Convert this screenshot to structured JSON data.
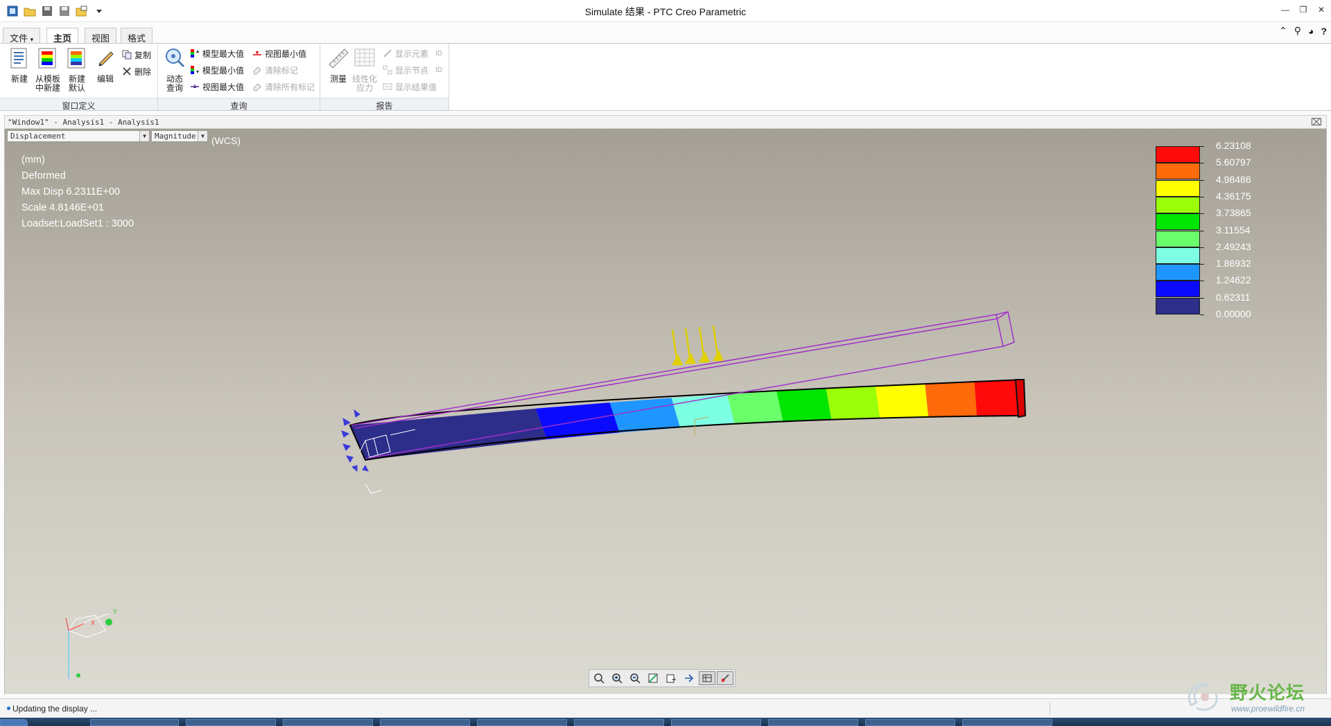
{
  "app": {
    "title": "Simulate 结果 - PTC Creo Parametric"
  },
  "ribbon": {
    "tabs": [
      "文件",
      "主页",
      "视图",
      "格式"
    ],
    "groups": {
      "window_def": {
        "label": "窗口定义",
        "new": "新建",
        "from_template_l1": "从模板",
        "from_template_l2": "中新建",
        "new_default_l1": "新建",
        "new_default_l2": "默认",
        "edit": "编辑",
        "copy": "复制",
        "delete": "删除"
      },
      "query": {
        "label": "查询",
        "dynamic_l1": "动态",
        "dynamic_l2": "查询",
        "model_max": "模型最大值",
        "model_min": "模型最小值",
        "view_max": "视图最大值",
        "view_min": "视图最小值",
        "clear_marks": "清除标记",
        "clear_all_marks": "清除所有标记"
      },
      "report": {
        "label": "报告",
        "measure": "测量",
        "linearize_l1": "线性化",
        "linearize_l2": "应力",
        "show_element": "显示元素",
        "show_node": "显示节点",
        "show_result": "显示结果值",
        "id_tag": "ID"
      }
    }
  },
  "window": {
    "header": "\"Window1\" - Analysis1 - Analysis1",
    "quantity_select": "Displacement",
    "component_select": "Magnitude",
    "wcs": "(WCS)"
  },
  "info": {
    "units": "(mm)",
    "state": "Deformed",
    "max_disp": "Max Disp  6.2311E+00",
    "scale": "Scale  4.8146E+01",
    "loadset": "Loadset:LoadSet1 : 3000"
  },
  "legend": {
    "values": [
      "6.23108",
      "5.60797",
      "4.98486",
      "4.36175",
      "3.73865",
      "3.11554",
      "2.49243",
      "1.86932",
      "1.24622",
      "0.62311",
      "0.00000"
    ],
    "colors": [
      "#ff0a0a",
      "#ff6a0a",
      "#ffff00",
      "#9cff0a",
      "#00e600",
      "#6aff6a",
      "#7dffe3",
      "#1f96ff",
      "#0a0aff",
      "#2d2d8a"
    ]
  },
  "status": {
    "text": "Updating the display ..."
  },
  "watermark": {
    "title": "野火论坛",
    "url": "www.proewildfire.cn"
  }
}
